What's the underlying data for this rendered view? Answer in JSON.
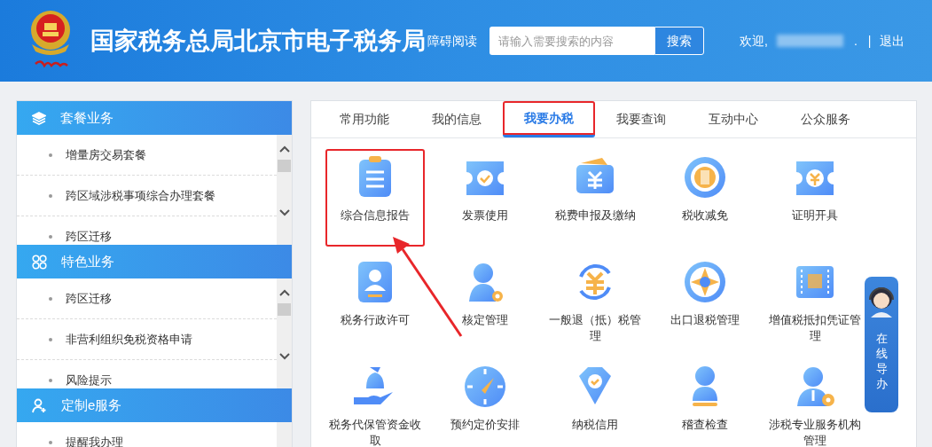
{
  "header": {
    "title": "国家税务总局北京市电子税务局",
    "accessibility_link": "障碍阅读",
    "search": {
      "placeholder": "请输入需要搜索的内容",
      "button": "搜索"
    },
    "welcome": "欢迎,",
    "user_suffix": ".",
    "separator": "|",
    "logout": "退出"
  },
  "sidebar": {
    "sections": [
      {
        "title": "套餐业务",
        "kind": "layers",
        "items": [
          "增量房交易套餐",
          "跨区域涉税事项综合办理套餐",
          "跨区迁移"
        ]
      },
      {
        "title": "特色业务",
        "kind": "grid",
        "items": [
          "跨区迁移",
          "非营利组织免税资格申请",
          "风险提示"
        ]
      },
      {
        "title": "定制e服务",
        "kind": "user",
        "items": [
          "提醒我办理"
        ]
      }
    ]
  },
  "tabs": [
    {
      "label": "常用功能",
      "selected": false,
      "highlighted": false
    },
    {
      "label": "我的信息",
      "selected": false,
      "highlighted": false
    },
    {
      "label": "我要办税",
      "selected": true,
      "highlighted": true
    },
    {
      "label": "我要查询",
      "selected": false,
      "highlighted": false
    },
    {
      "label": "互动中心",
      "selected": false,
      "highlighted": false
    },
    {
      "label": "公众服务",
      "selected": false,
      "highlighted": false
    }
  ],
  "services": [
    {
      "label": "综合信息报告",
      "highlighted": true
    },
    {
      "label": "发票使用",
      "highlighted": false
    },
    {
      "label": "税费申报及缴纳",
      "highlighted": false
    },
    {
      "label": "税收减免",
      "highlighted": false
    },
    {
      "label": "证明开具",
      "highlighted": false
    },
    {
      "label": "税务行政许可",
      "highlighted": false
    },
    {
      "label": "核定管理",
      "highlighted": false
    },
    {
      "label": "一般退（抵）税管理",
      "highlighted": false
    },
    {
      "label": "出口退税管理",
      "highlighted": false
    },
    {
      "label": "增值税抵扣凭证管理",
      "highlighted": false
    },
    {
      "label": "税务代保管资金收取",
      "highlighted": false
    },
    {
      "label": "预约定价安排",
      "highlighted": false
    },
    {
      "label": "纳税信用",
      "highlighted": false
    },
    {
      "label": "稽查检查",
      "highlighted": false
    },
    {
      "label": "涉税专业服务机构管理",
      "highlighted": false
    }
  ],
  "online_guide": {
    "label": "在线导办"
  }
}
